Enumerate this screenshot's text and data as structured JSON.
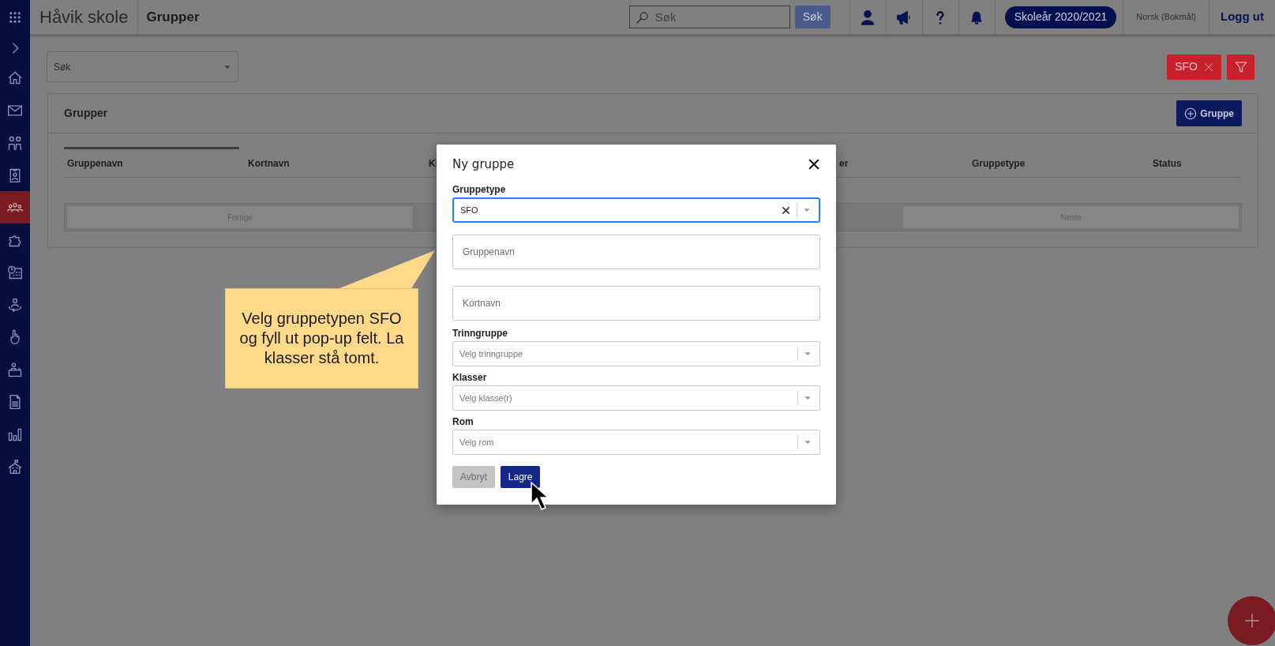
{
  "topbar": {
    "school": "Håvik skole",
    "page_title": "Grupper",
    "search": {
      "placeholder": "Søk"
    },
    "search_button": "Søk",
    "school_year": "Skoleår 2020/2021",
    "language": "Norsk (Bokmål)",
    "logout": "Logg ut"
  },
  "sidebar": {
    "items": [
      {
        "selected": false
      },
      {
        "selected": false
      },
      {
        "selected": false
      },
      {
        "selected": false
      },
      {
        "selected": true
      },
      {
        "selected": false
      },
      {
        "selected": false
      },
      {
        "selected": false
      },
      {
        "selected": false
      },
      {
        "selected": false
      },
      {
        "selected": false
      },
      {
        "selected": false
      },
      {
        "selected": false
      }
    ]
  },
  "filters": {
    "search_select": "Søk",
    "chips": [
      {
        "label": "SFO"
      }
    ]
  },
  "groups_card": {
    "title": "Grupper",
    "add_button": "Gruppe",
    "columns": [
      {
        "label": "Gruppenavn"
      },
      {
        "label": "Kortnavn"
      },
      {
        "label": "Kl"
      },
      {
        "label": "er"
      },
      {
        "label": "Gruppetype"
      },
      {
        "label": "Status"
      }
    ],
    "pagination": {
      "previous": "Forrige",
      "next": "Neste"
    }
  },
  "dialog": {
    "title": "Ny gruppe",
    "fields": [
      {
        "kind": "select",
        "label": "Gruppetype",
        "value": "SFO",
        "focused": true
      },
      {
        "kind": "text",
        "placeholder": "Gruppenavn"
      },
      {
        "kind": "text",
        "placeholder": "Kortnavn"
      },
      {
        "kind": "select",
        "label": "Trinngruppe",
        "placeholder": "Velg trinngruppe",
        "focused": false
      },
      {
        "kind": "select",
        "label": "Klasser",
        "placeholder": "Velg klasse(r)",
        "focused": false
      },
      {
        "kind": "select",
        "label": "Rom",
        "placeholder": "Velg rom",
        "focused": false
      }
    ],
    "buttons": [
      {
        "label": "Avbryt",
        "kind": "secondary"
      },
      {
        "label": "Lagre",
        "kind": "primary"
      }
    ]
  },
  "callout": {
    "text": "Velg gruppetypen SFO og fyll ut pop-up felt. La klasser stå tomt."
  }
}
